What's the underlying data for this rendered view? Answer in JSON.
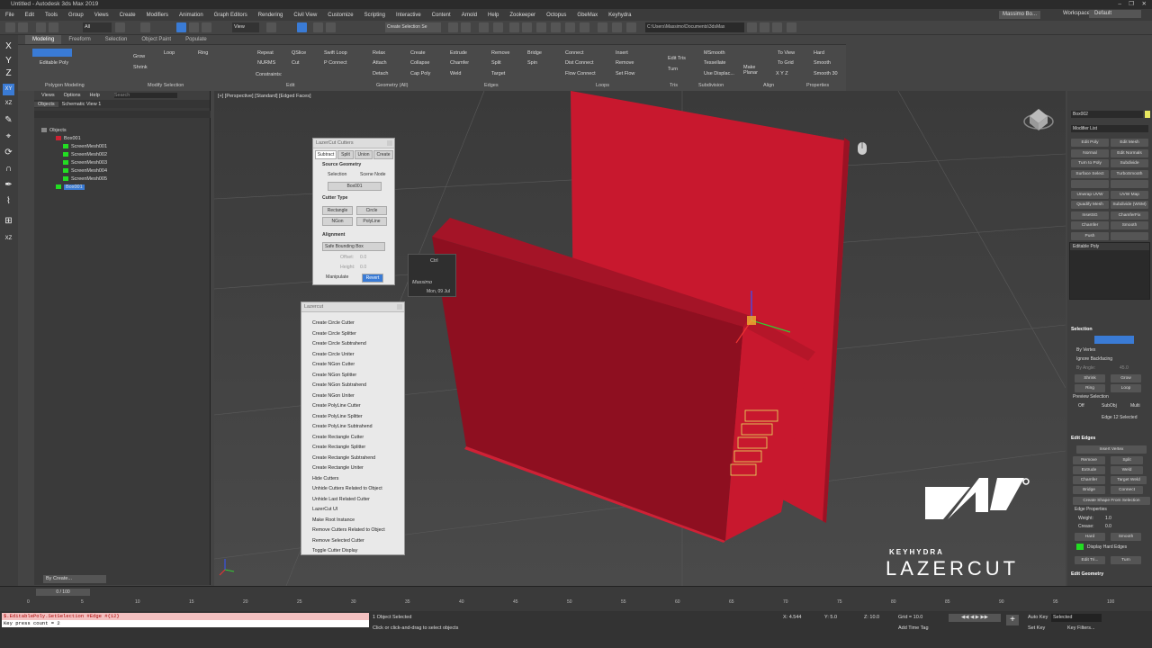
{
  "window": {
    "title": "Untitled - Autodesk 3ds Max 2019"
  },
  "menu": [
    "File",
    "Edit",
    "Tools",
    "Group",
    "Views",
    "Create",
    "Modifiers",
    "Animation",
    "Graph Editors",
    "Rendering",
    "Civil View",
    "Customize",
    "Scripting",
    "Interactive",
    "Content",
    "Arnold",
    "Help",
    "Zookeeper",
    "Octopus",
    "GbeMax",
    "Keyhydra"
  ],
  "user": {
    "name": "Massimo Bo...",
    "workspaces_label": "Workspaces:",
    "workspace": "Default"
  },
  "toolbar": {
    "selection_set": "Create Selection Se",
    "path": "C:\\Users\\Massimo\\Documents\\3dsMax",
    "view": "View",
    "all": "All"
  },
  "ribbon": {
    "tabs": [
      "Modeling",
      "Freeform",
      "Selection",
      "Object Paint",
      "Populate"
    ],
    "groups": [
      "Polygon Modeling",
      "Modify Selection",
      "Edit",
      "Geometry (All)",
      "Edges",
      "Loops",
      "Subdivision",
      "Tris",
      "Align",
      "Properties"
    ],
    "items": {
      "editable_poly": "Editable Poly",
      "grow": "Grow",
      "shrink": "Shrink",
      "loop": "Loop",
      "ring": "Ring",
      "repeat": "Repeat",
      "nurms": "NURMS",
      "constraints": "Constraints:",
      "qslice": "QSlice",
      "cut": "Cut",
      "swiftloop": "Swift Loop",
      "pconnect": "P Connect",
      "relax": "Relax",
      "attach": "Attach",
      "detach": "Detach",
      "create": "Create",
      "collapse": "Collapse",
      "cap_poly": "Cap Poly",
      "extrude": "Extrude",
      "chamfer": "Chamfer",
      "weld": "Weld",
      "remove": "Remove",
      "split": "Split",
      "target": "Target",
      "bridge": "Bridge",
      "spin": "Spin",
      "connect": "Connect",
      "dist_connect": "Dist Connect",
      "flow_connect": "Flow Connect",
      "insert": "Insert",
      "remove2": "Remove",
      "set_flow": "Set Flow",
      "edit_tris": "Edit Tris",
      "turn": "Turn",
      "msmooth": "MSmooth",
      "tessellate": "Tessellate",
      "use_displace": "Use Displac...",
      "make_planar": "Make Planar",
      "to_view": "To View",
      "to_grid": "To Grid",
      "xyz": "X  Y  Z",
      "hard": "Hard",
      "smooth": "Smooth",
      "smooth30": "Smooth 30"
    }
  },
  "explorer": {
    "tabs": [
      "Views",
      "Options",
      "Help"
    ],
    "search": "Search",
    "subtabs": [
      "Objects",
      "Schematic View 1"
    ],
    "tree": [
      {
        "label": "Objects",
        "color": "#888888"
      },
      {
        "label": "Box001",
        "color": "#cc2233"
      },
      {
        "label": "ScreenMesh001",
        "color": "#22dd22"
      },
      {
        "label": "ScreenMesh002",
        "color": "#22dd22"
      },
      {
        "label": "ScreenMesh003",
        "color": "#22dd22"
      },
      {
        "label": "ScreenMesh004",
        "color": "#22dd22"
      },
      {
        "label": "ScreenMesh005",
        "color": "#22dd22"
      },
      {
        "label": "Box001",
        "color": "#22dd22"
      }
    ],
    "footer": "By Create..."
  },
  "viewport": {
    "label": "[+] [Perspective] [Standard] [Edged Faces]"
  },
  "lazercut_cutters": {
    "title": "LazerCut Cutters",
    "tabs": [
      "Subtract",
      "Split",
      "Union",
      "Create"
    ],
    "source_geometry": "Source Geometry",
    "selection": "Selection",
    "scene_node": "Scene Node",
    "node": "Box001",
    "cutter_type": "Cutter Type",
    "types": [
      "Rectangle",
      "Circle",
      "NGon",
      "PolyLine"
    ],
    "alignment": "Alignment",
    "bbox": "Safe Bounding Box",
    "offset": "Offset:",
    "offset_val": "0.0",
    "height": "Height:",
    "height_val": "0.0",
    "manipulate": "Manipulate",
    "revert": "Revert"
  },
  "lazercut_menu": {
    "title": "Lazercut",
    "items": [
      "Create Circle Cutter",
      "Create Circle Splitter",
      "Create Circle Subtrahend",
      "Create Circle Uniter",
      "Create NGon Cutter",
      "Create NGon Splitter",
      "Create NGon Subtrahend",
      "Create NGon Uniter",
      "Create PolyLine Cutter",
      "Create PolyLine Splitter",
      "Create PolyLine Subtrahend",
      "Create Rectangle Cutter",
      "Create Rectangle Splitter",
      "Create Rectangle Subtrahend",
      "Create Rectangle Uniter",
      "Hide Cutters",
      "Unhide Cutters Related to Object",
      "Unhide Last Related Cutter",
      "LazerCut UI",
      "Make Root Instance",
      "Remove Cutters Related to Object",
      "Remove Selected Cutter",
      "Toggle Cutter Display"
    ]
  },
  "ctrl_tip": {
    "key": "Ctrl",
    "user": "Massimo",
    "date": "Mon, 09 Jul"
  },
  "brand": {
    "sub": "KEYHYDRA",
    "name": "LAZERCUT"
  },
  "command_panel": {
    "object_name": "Box002",
    "modifier_list": "Modifier List",
    "buttons": [
      "Edit Poly",
      "Edit Mesh",
      "Normal",
      "Edit Normals",
      "Turn to Poly",
      "Subdivide",
      "Surface Select",
      "TurboSmooth",
      "",
      "",
      "Unwrap UVW",
      "UVW Map",
      "Quadify Mesh",
      "Subdivide (WSM)",
      "InsetSG",
      "ChamferFix",
      "Chamfer",
      "Smooth",
      "Push",
      ""
    ],
    "stack_item": "Editable Poly",
    "selection": "Selection",
    "by_vertex": "By Vertex",
    "ignore_backfacing": "Ignore Backfacing",
    "by_angle": "By Angle:",
    "by_angle_val": "45.0",
    "shrink": "Shrink",
    "grow": "Grow",
    "ring": "Ring",
    "loop": "Loop",
    "preview_selection": "Preview Selection",
    "preview_opts": [
      "Off",
      "SubObj",
      "Multi"
    ],
    "edge_selected": "Edge 12 Selected",
    "edit_edges": "Edit Edges",
    "insert_vertex": "Insert Vertex",
    "remove": "Remove",
    "split": "Split",
    "extrude": "Extrude",
    "weld": "Weld",
    "chamfer": "Chamfer",
    "target_weld": "Target Weld",
    "bridge": "Bridge",
    "connect": "Connect",
    "create_shape": "Create Shape From Selection",
    "edge_properties": "Edge Properties",
    "weight": "Weight:",
    "weight_val": "1.0",
    "crease": "Crease:",
    "crease_val": "0.0",
    "hard": "Hard",
    "smooth": "Smooth",
    "display_hard": "Display Hard Edges",
    "edit_tri": "Edit Tri...",
    "turn": "Turn",
    "edit_geometry": "Edit Geometry"
  },
  "timeline": {
    "frame": "0 / 100",
    "ticks": [
      "0",
      "5",
      "10",
      "15",
      "20",
      "25",
      "30",
      "35",
      "40",
      "45",
      "50",
      "55",
      "60",
      "65",
      "70",
      "75",
      "80",
      "85",
      "90",
      "95",
      "100"
    ]
  },
  "status": {
    "maxscript_line1": "$.EditablePoly.SetSelection #Edge #{12}",
    "maxscript_line2": "Key press count = 2",
    "selected": "1 Object Selected",
    "hint": "Click or click-and-drag to select objects",
    "x": "X: 4.544",
    "y": "Y: 5.0",
    "z": "Z: 10.0",
    "grid": "Grid = 10.0",
    "add_time_tag": "Add Time Tag",
    "auto_key": "Auto Key",
    "selected_dd": "Selected",
    "set_key": "Set Key",
    "key_filters": "Key Filters..."
  },
  "colors": {
    "box": "#c8182e",
    "box_dark": "#8e0f20",
    "brand": "#ffffff",
    "accent": "#3a7bd5"
  }
}
